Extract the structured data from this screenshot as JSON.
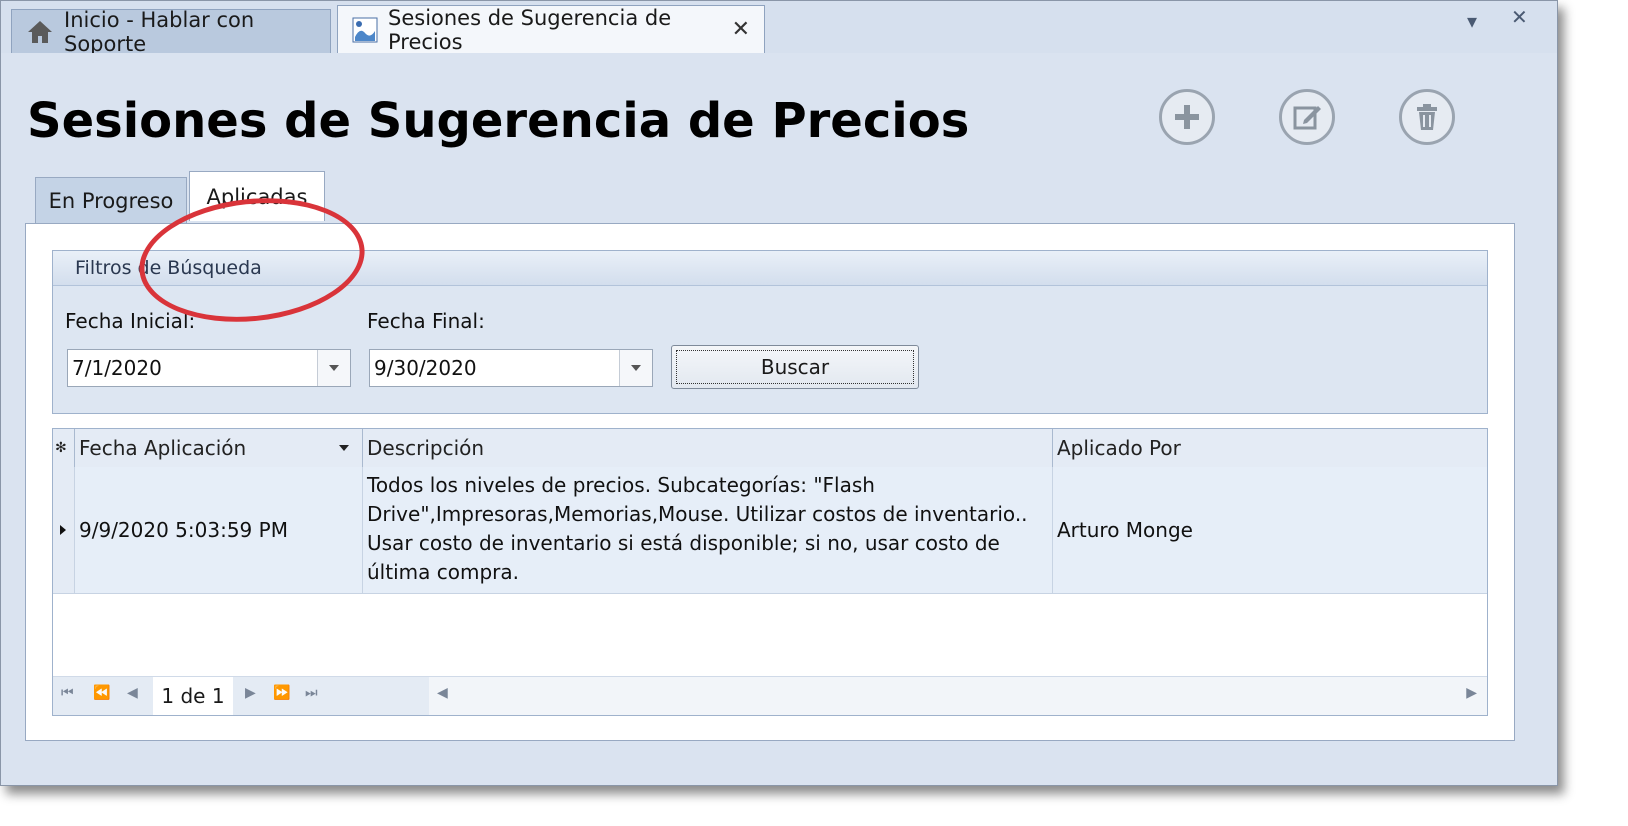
{
  "doc_tabs": {
    "home_label": "Inicio - Hablar con Soporte",
    "active_label": "Sesiones de Sugerencia de Precios"
  },
  "page": {
    "title": "Sesiones de Sugerencia de Precios"
  },
  "tabs": [
    {
      "label": "En Progreso",
      "selected": false
    },
    {
      "label": "Aplicadas",
      "selected": true
    }
  ],
  "filters": {
    "header": "Filtros de Búsqueda",
    "start_label": "Fecha Inicial:",
    "start_value": "7/1/2020",
    "end_label": "Fecha Final:",
    "end_value": "9/30/2020",
    "search_button": "Buscar"
  },
  "grid": {
    "columns": [
      "Fecha Aplicación",
      "Descripción",
      "Aplicado Por"
    ],
    "rows": [
      {
        "fecha": "9/9/2020 5:03:59 PM",
        "descripcion": "Todos los niveles de precios. Subcategorías: \"Flash Drive\",Impresoras,Memorias,Mouse. Utilizar costos de inventario.. Usar costo de inventario si está disponible; si no, usar costo de última compra.",
        "aplicado_por": "Arturo Monge"
      }
    ],
    "pager_text": "1 de 1"
  },
  "colors": {
    "annotation": "#d9343a",
    "window_bg": "#d6e0ee"
  }
}
